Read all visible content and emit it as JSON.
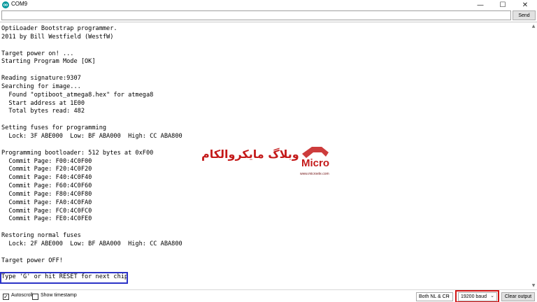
{
  "window": {
    "title": "COM9",
    "minimize_glyph": "—",
    "maximize_glyph": "☐",
    "close_glyph": "✕"
  },
  "send": {
    "input_value": "",
    "button_label": "Send"
  },
  "output": {
    "lines": [
      "OptiLoader Bootstrap programmer.",
      "2011 by Bill Westfield (WestfW)",
      "",
      "Target power on! ...",
      "Starting Program Mode [OK]",
      "",
      "Reading signature:9307",
      "Searching for image...",
      "  Found \"optiboot_atmega8.hex\" for atmega8",
      "  Start address at 1E00",
      "  Total bytes read: 482",
      "",
      "Setting fuses for programming",
      "  Lock: 3F ABE000  Low: BF ABA000  High: CC ABA800",
      "",
      "Programming bootloader: 512 bytes at 0xF00",
      "  Commit Page: F00:4C0F00",
      "  Commit Page: F20:4C0F20",
      "  Commit Page: F40:4C0F40",
      "  Commit Page: F60:4C0F60",
      "  Commit Page: F80:4C0F80",
      "  Commit Page: FA0:4C0FA0",
      "  Commit Page: FC0:4C0FC0",
      "  Commit Page: FE0:4C0FE0",
      "",
      "Restoring normal fuses",
      "  Lock: 2F ABE000  Low: BF ABA000  High: CC ABA800",
      "",
      "Target power OFF!",
      "",
      "Type 'G' or hit RESET for next chip"
    ]
  },
  "watermark": {
    "text": "وبلاگ مایکروالکام",
    "logo_text": "Micro",
    "site": "www.microele.com"
  },
  "footer": {
    "autoscroll_label": "Autoscroll",
    "autoscroll_checked": true,
    "timestamp_label": "Show timestamp",
    "timestamp_checked": false,
    "line_ending": "Both NL & CR",
    "baud_rate": "19200 baud",
    "clear_label": "Clear output"
  },
  "colors": {
    "arduino_teal": "#00979c",
    "highlight_blue": "#2b33c7",
    "highlight_red": "#d01818",
    "watermark_red": "#c41a1a"
  }
}
